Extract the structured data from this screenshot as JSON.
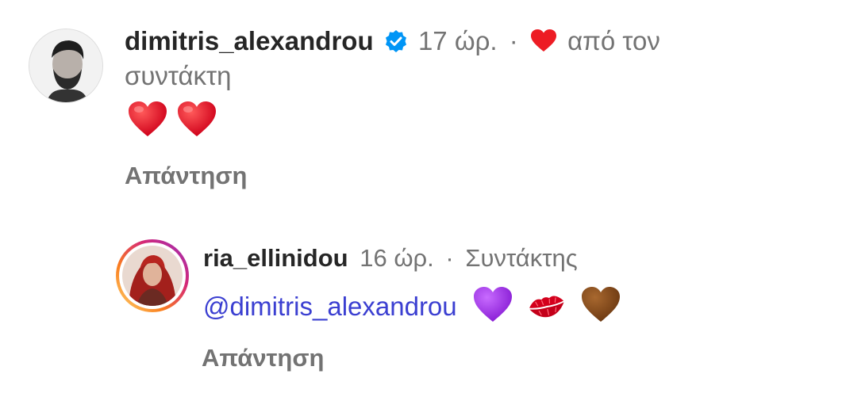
{
  "comments": [
    {
      "username": "dimitris_alexandrou",
      "verified": true,
      "time": "17 ώρ.",
      "separator": "·",
      "liked_by_creator_prefix_icon": "red-heart-icon",
      "liked_by_creator_text_1": "από τον",
      "liked_by_creator_text_2": "συντάκτη",
      "body_emojis": [
        "❤️",
        "❤️"
      ],
      "reply_label": "Απάντηση"
    },
    {
      "username": "ria_ellinidou",
      "time": "16 ώρ.",
      "separator": "·",
      "role": "Συντάκτης",
      "mention": "@dimitris_alexandrou",
      "body_emojis": [
        "💜",
        "💋",
        "🤎"
      ],
      "reply_label": "Απάντηση",
      "story_ring": true
    }
  ],
  "colors": {
    "name": "#262626",
    "meta": "#737373",
    "mention": "#3b3fd1",
    "verified": "#0095f6",
    "heart": "#ed1c24"
  }
}
